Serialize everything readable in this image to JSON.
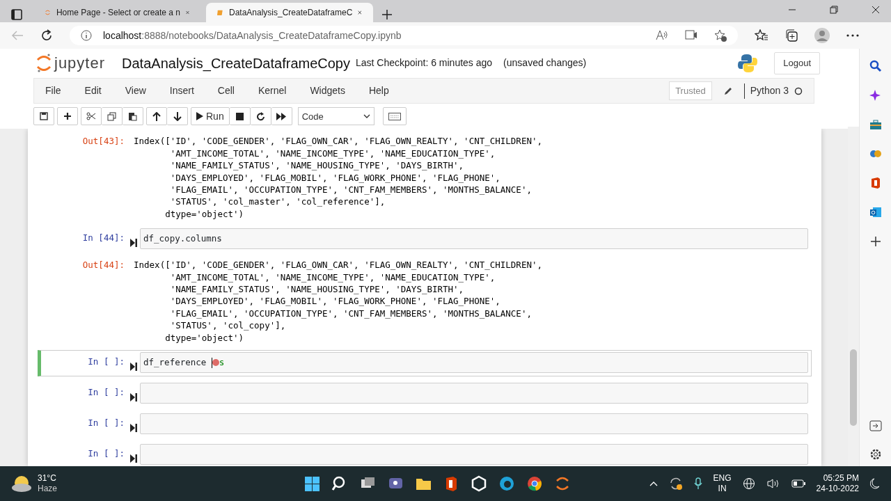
{
  "browser": {
    "tabs": [
      {
        "title": "Home Page - Select or create a n",
        "selected": false
      },
      {
        "title": "DataAnalysis_CreateDataframeC",
        "selected": true
      }
    ],
    "url_host": "localhost",
    "url_path": ":8888/notebooks/DataAnalysis_CreateDataframeCopy.ipynb"
  },
  "header": {
    "logo_text": "jupyter",
    "title": "DataAnalysis_CreateDataframeCopy",
    "checkpoint": "Last Checkpoint: 6 minutes ago",
    "unsaved": "(unsaved changes)",
    "logout": "Logout"
  },
  "menu": [
    "File",
    "Edit",
    "View",
    "Insert",
    "Cell",
    "Kernel",
    "Widgets",
    "Help"
  ],
  "kernel_area": {
    "trusted": "Trusted",
    "kernel": "Python 3"
  },
  "toolbar": {
    "run": "Run",
    "cell_type": "Code"
  },
  "cells": [
    {
      "kind": "output",
      "prompt": "Out[43]:",
      "lines": [
        "Index(['ID', 'CODE_GENDER', 'FLAG_OWN_CAR', 'FLAG_OWN_REALTY', 'CNT_CHILDREN',",
        "       'AMT_INCOME_TOTAL', 'NAME_INCOME_TYPE', 'NAME_EDUCATION_TYPE',",
        "       'NAME_FAMILY_STATUS', 'NAME_HOUSING_TYPE', 'DAYS_BIRTH',",
        "       'DAYS_EMPLOYED', 'FLAG_MOBIL', 'FLAG_WORK_PHONE', 'FLAG_PHONE',",
        "       'FLAG_EMAIL', 'OCCUPATION_TYPE', 'CNT_FAM_MEMBERS', 'MONTHS_BALANCE',",
        "       'STATUS', 'col_master', 'col_reference'],",
        "      dtype='object')"
      ]
    },
    {
      "kind": "code",
      "prompt": "In [44]:",
      "code": "df_copy.columns",
      "selected": false
    },
    {
      "kind": "output",
      "prompt": "Out[44]:",
      "lines": [
        "Index(['ID', 'CODE_GENDER', 'FLAG_OWN_CAR', 'FLAG_OWN_REALTY', 'CNT_CHILDREN',",
        "       'AMT_INCOME_TOTAL', 'NAME_INCOME_TYPE', 'NAME_EDUCATION_TYPE',",
        "       'NAME_FAMILY_STATUS', 'NAME_HOUSING_TYPE', 'DAYS_BIRTH',",
        "       'DAYS_EMPLOYED', 'FLAG_MOBIL', 'FLAG_WORK_PHONE', 'FLAG_PHONE',",
        "       'FLAG_EMAIL', 'OCCUPATION_TYPE', 'CNT_FAM_MEMBERS', 'MONTHS_BALANCE',",
        "       'STATUS', 'col_copy'],",
        "      dtype='object')"
      ]
    },
    {
      "kind": "code",
      "prompt": "In [ ]:",
      "code": "df_reference",
      "code_after": "s",
      "selected": true
    },
    {
      "kind": "code",
      "prompt": "In [ ]:",
      "selected": false
    },
    {
      "kind": "code",
      "prompt": "In [ ]:",
      "selected": false
    },
    {
      "kind": "code",
      "prompt": "In [ ]:",
      "selected": false
    }
  ],
  "taskbar": {
    "temperature": "31°C",
    "weather": "Haze",
    "lang": "ENG",
    "region": "IN",
    "time": "05:25 PM",
    "date": "24-10-2022"
  }
}
